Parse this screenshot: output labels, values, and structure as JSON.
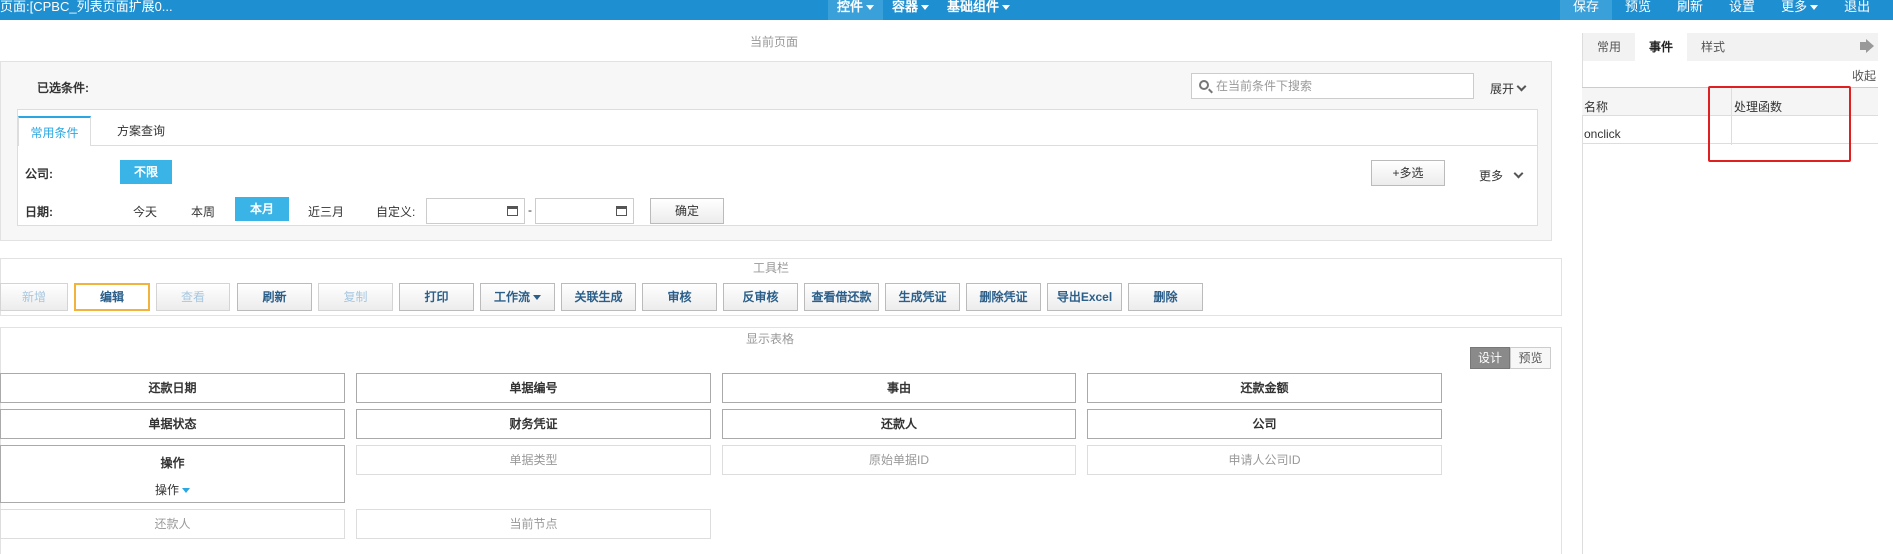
{
  "topbar": {
    "title": "页面:[CPBC_列表页面扩展0...",
    "menus": [
      "控件",
      "容器",
      "基础组件"
    ],
    "actions": [
      "保存",
      "预览",
      "刷新",
      "设置",
      "更多",
      "退出"
    ]
  },
  "sections": {
    "current_page": "当前页面",
    "toolbar": "工具栏",
    "table": "显示表格"
  },
  "filter": {
    "selected_label": "已选条件:",
    "search_placeholder": "在当前条件下搜索",
    "expand": "展开",
    "tabs": [
      "常用条件",
      "方案查询"
    ],
    "company_label": "公司:",
    "company_chip": "不限",
    "multi_select": "+多选",
    "more": "更多",
    "date_label": "日期:",
    "date_opts": [
      "今天",
      "本周",
      "本月",
      "近三月"
    ],
    "custom_label": "自定义:",
    "dash": "-",
    "confirm": "确定"
  },
  "toolbar": {
    "buttons": [
      "新增",
      "编辑",
      "查看",
      "刷新",
      "复制",
      "打印",
      "工作流",
      "关联生成",
      "审核",
      "反审核",
      "查看借还款",
      "生成凭证",
      "删除凭证",
      "导出Excel",
      "删除"
    ]
  },
  "grid": {
    "mode": [
      "设计",
      "预览"
    ],
    "row1": [
      "还款日期",
      "单据编号",
      "事由",
      "还款金额"
    ],
    "row2": [
      "单据状态",
      "财务凭证",
      "还款人",
      "公司"
    ],
    "row3_first": "操作",
    "row3_sub": "操作",
    "row3": [
      "单据类型",
      "原始单据ID",
      "申请人公司ID"
    ],
    "row4": [
      "还款人",
      "当前节点"
    ]
  },
  "right_panel": {
    "tabs": [
      "常用",
      "事件",
      "样式"
    ],
    "collapse": "收起",
    "col_name": "名称",
    "col_handler": "处理函数",
    "event_name": "onclick",
    "event_handler": "",
    "highlight_color": "#e02020"
  }
}
